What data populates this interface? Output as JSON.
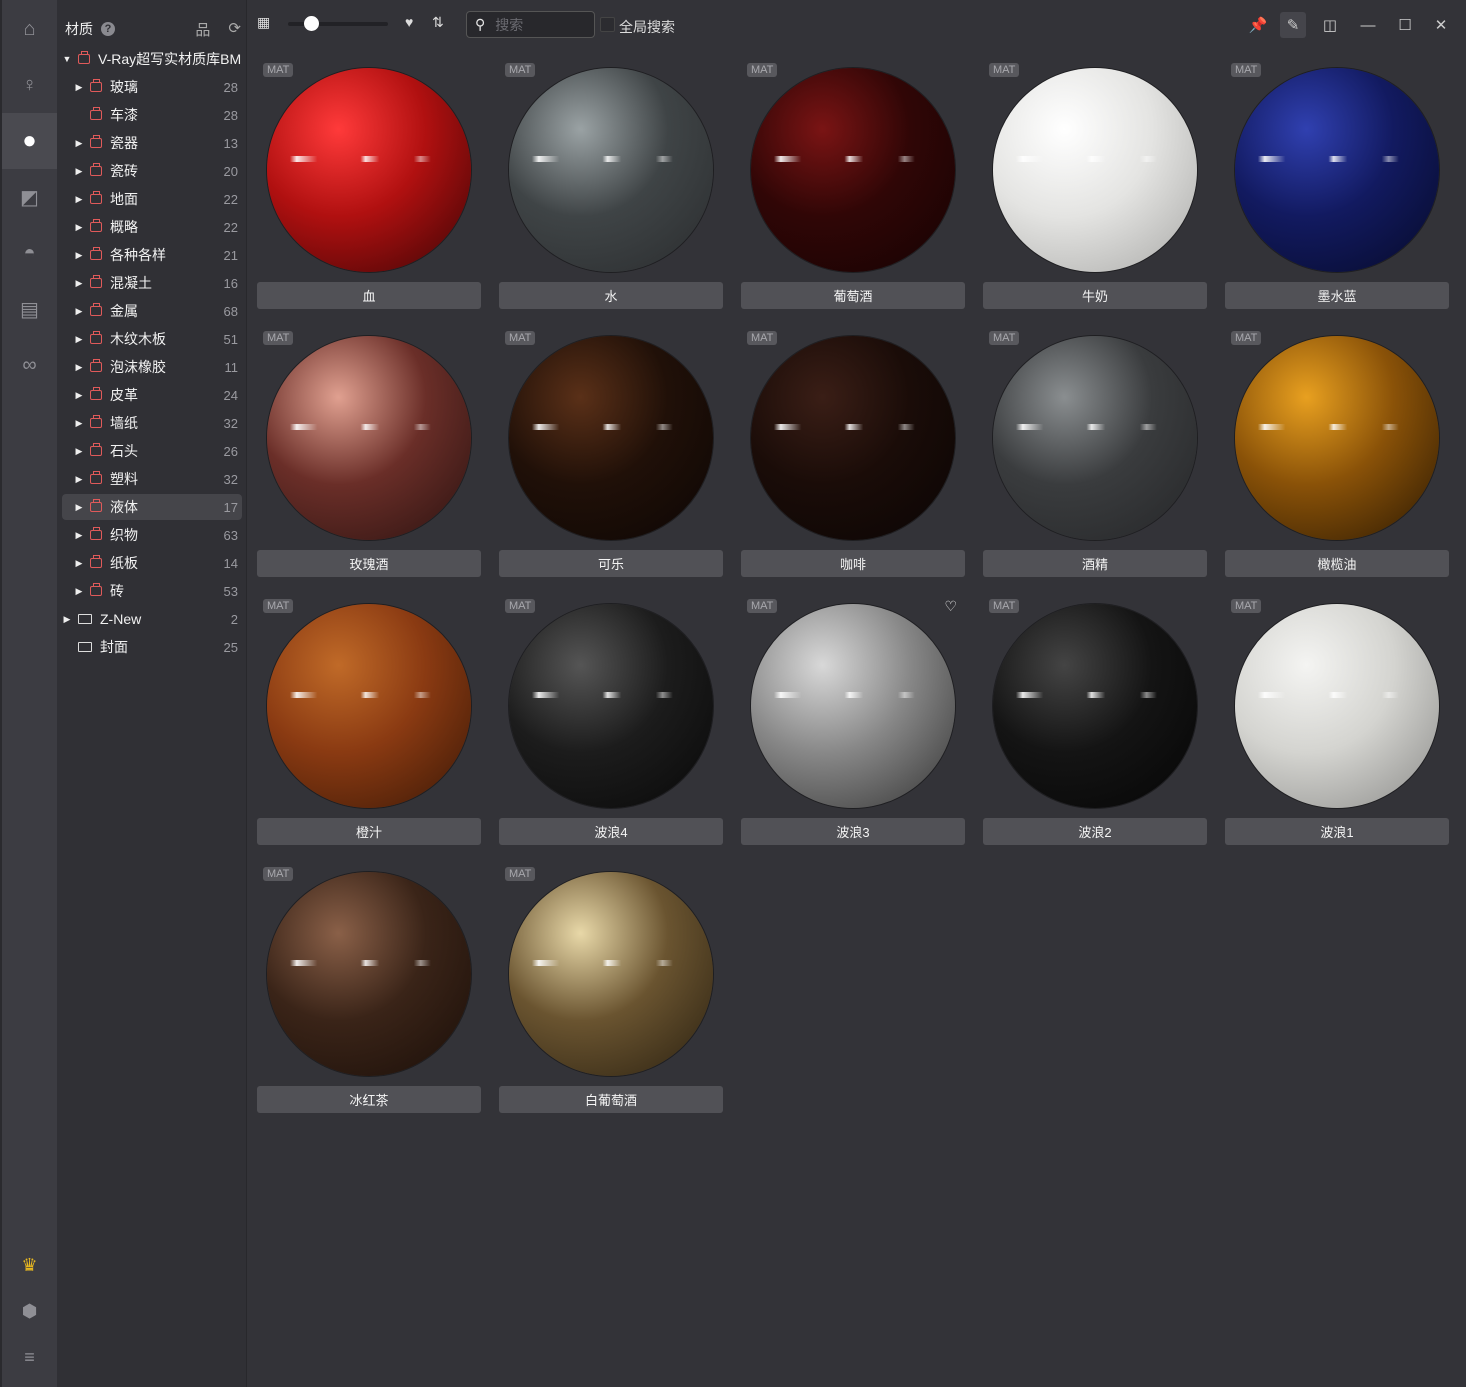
{
  "rail": {
    "items": [
      {
        "icon": "home-icon"
      },
      {
        "icon": "lamp-icon"
      },
      {
        "icon": "material-sphere-icon",
        "active": true
      },
      {
        "icon": "texture-icon"
      },
      {
        "icon": "hdri-dome-icon"
      },
      {
        "icon": "script-icon"
      },
      {
        "icon": "infinity-icon"
      }
    ],
    "bottom": [
      {
        "icon": "crown-icon",
        "color": "#e8b820"
      },
      {
        "icon": "cube-icon"
      },
      {
        "icon": "menu-icon"
      }
    ]
  },
  "tree": {
    "title": "材质",
    "root": {
      "label": "V-Ray超写实材质库BM"
    },
    "items": [
      {
        "label": "玻璃",
        "count": "28",
        "arrow": true
      },
      {
        "label": "车漆",
        "count": "28",
        "arrow": false
      },
      {
        "label": "瓷器",
        "count": "13",
        "arrow": true
      },
      {
        "label": "瓷砖",
        "count": "20",
        "arrow": true
      },
      {
        "label": "地面",
        "count": "22",
        "arrow": true
      },
      {
        "label": "概略",
        "count": "22",
        "arrow": true
      },
      {
        "label": "各种各样",
        "count": "21",
        "arrow": true
      },
      {
        "label": "混凝土",
        "count": "16",
        "arrow": true
      },
      {
        "label": "金属",
        "count": "68",
        "arrow": true
      },
      {
        "label": "木纹木板",
        "count": "51",
        "arrow": true
      },
      {
        "label": "泡沫橡胶",
        "count": "11",
        "arrow": true
      },
      {
        "label": "皮革",
        "count": "24",
        "arrow": true
      },
      {
        "label": "墙纸",
        "count": "32",
        "arrow": true
      },
      {
        "label": "石头",
        "count": "26",
        "arrow": true
      },
      {
        "label": "塑料",
        "count": "32",
        "arrow": true
      },
      {
        "label": "液体",
        "count": "17",
        "arrow": true,
        "selected": true
      },
      {
        "label": "织物",
        "count": "63",
        "arrow": true
      },
      {
        "label": "纸板",
        "count": "14",
        "arrow": true
      },
      {
        "label": "砖",
        "count": "53",
        "arrow": true
      }
    ],
    "folders": [
      {
        "label": "Z-New",
        "count": "2",
        "arrow": true
      },
      {
        "label": "封面",
        "count": "25",
        "arrow": false
      }
    ]
  },
  "toolbar": {
    "search_placeholder": "搜索",
    "global_search": "全局搜索",
    "size_slider": 0.2
  },
  "badge": "MAT",
  "materials": [
    {
      "name": "血",
      "c": [
        "#ff3a3a",
        "#b01010",
        "#3a0505"
      ]
    },
    {
      "name": "水",
      "c": [
        "#9aa2a4",
        "#3f4446",
        "#2a2c2e"
      ]
    },
    {
      "name": "葡萄酒",
      "c": [
        "#7a1414",
        "#300606",
        "#150303"
      ]
    },
    {
      "name": "牛奶",
      "c": [
        "#ffffff",
        "#e4e4e2",
        "#a8a8a6"
      ]
    },
    {
      "name": "墨水蓝",
      "c": [
        "#3040b0",
        "#121a60",
        "#060a28"
      ]
    },
    {
      "name": "玫瑰酒",
      "c": [
        "#e0a090",
        "#6a2e28",
        "#2a1210"
      ]
    },
    {
      "name": "可乐",
      "c": [
        "#5a3018",
        "#201008",
        "#0c0604"
      ]
    },
    {
      "name": "咖啡",
      "c": [
        "#3a1e16",
        "#1a0c08",
        "#0a0504"
      ]
    },
    {
      "name": "酒精",
      "c": [
        "#8a8e90",
        "#3a3c3e",
        "#252628"
      ]
    },
    {
      "name": "橄榄油",
      "c": [
        "#e8a020",
        "#8a5208",
        "#2a1802"
      ]
    },
    {
      "name": "橙汁",
      "c": [
        "#c06a28",
        "#8a3a12",
        "#3a1806"
      ]
    },
    {
      "name": "波浪4",
      "c": [
        "#555",
        "#1c1c1c",
        "#080808"
      ]
    },
    {
      "name": "波浪3",
      "c": [
        "#d8d8d8",
        "#888",
        "#333"
      ],
      "favorite": true
    },
    {
      "name": "波浪2",
      "c": [
        "#444",
        "#141414",
        "#050505"
      ]
    },
    {
      "name": "波浪1",
      "c": [
        "#f4f4f2",
        "#d4d4d0",
        "#8a8a88"
      ]
    },
    {
      "name": "冰红茶",
      "c": [
        "#8a6048",
        "#3a2418",
        "#1a0e08"
      ]
    },
    {
      "name": "白葡萄酒",
      "c": [
        "#e8d8a8",
        "#6a5430",
        "#2a2010"
      ]
    }
  ]
}
